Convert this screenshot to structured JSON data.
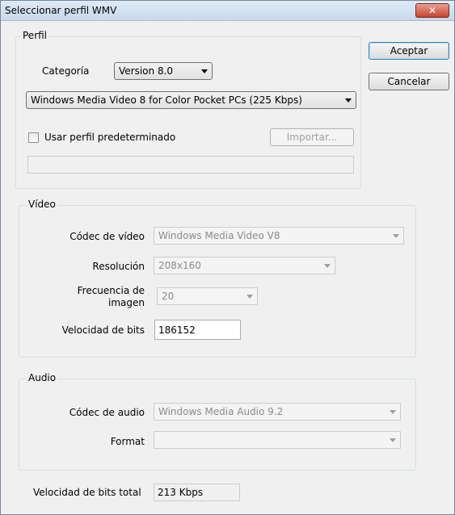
{
  "window": {
    "title": "Seleccionar perfil WMV",
    "close_glyph": "✕"
  },
  "buttons": {
    "accept": "Aceptar",
    "cancel": "Cancelar"
  },
  "perfil": {
    "legend": "Perfil",
    "category_label": "Categoría",
    "category_value": "Version 8.0",
    "profile_value": "Windows Media Video 8 for Color Pocket PCs (225 Kbps)",
    "use_default_label": "Usar perfil predeterminado",
    "use_default_checked": false,
    "import_label": "Importar...",
    "description_value": ""
  },
  "video": {
    "legend": "Vídeo",
    "codec_label": "Códec de vídeo",
    "codec_value": "Windows Media Video V8",
    "resolution_label": "Resolución",
    "resolution_value": "208x160",
    "framerate_label_1": "Frecuencia de",
    "framerate_label_2": "imagen",
    "framerate_value": "20",
    "bitrate_label": "Velocidad de bits",
    "bitrate_value": "186152"
  },
  "audio": {
    "legend": "Audio",
    "codec_label": "Códec de audio",
    "codec_value": "Windows Media Audio 9.2",
    "format_label": "Format",
    "format_value": ""
  },
  "total": {
    "label": "Velocidad de bits total",
    "value": "213 Kbps"
  }
}
